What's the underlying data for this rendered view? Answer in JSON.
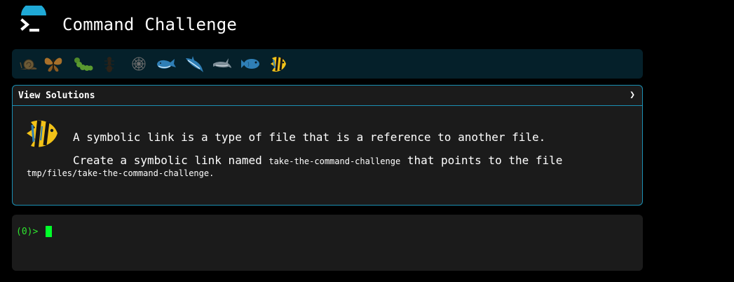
{
  "app": {
    "title": "Command Challenge",
    "logo_icon": "terminal-prompt-icon",
    "logo_accent": "#1fa9d6"
  },
  "levels": {
    "items": [
      {
        "icon": "snail-icon"
      },
      {
        "icon": "butterfly-icon"
      },
      {
        "icon": "caterpillar-icon"
      },
      {
        "icon": "ant-icon"
      },
      {
        "icon": "spider-web-icon"
      },
      {
        "icon": "whale-icon"
      },
      {
        "icon": "shark-icon"
      },
      {
        "icon": "dolphin-icon"
      },
      {
        "icon": "fish-icon"
      },
      {
        "icon": "angelfish-icon"
      }
    ],
    "active_index": 9
  },
  "challenge": {
    "header_label": "View Solutions",
    "chevron": "❯",
    "icon": "angelfish-icon",
    "description_line1": "A symbolic link is a type of file that is a reference to another file.",
    "line2_prefix": "Create a symbolic link named ",
    "link_name": "take-the-command-challenge",
    "line2_suffix": " that points to the file",
    "target_path": "tmp/files/take-the-command-challenge",
    "line3_suffix": "."
  },
  "terminal": {
    "prompt": "(0)>",
    "input_value": ""
  },
  "colors": {
    "background": "#000000",
    "level_bar": "#05202a",
    "panel": "#1b1b1b",
    "panel_border": "#1b8fb3",
    "prompt_green": "#2ee62e"
  }
}
